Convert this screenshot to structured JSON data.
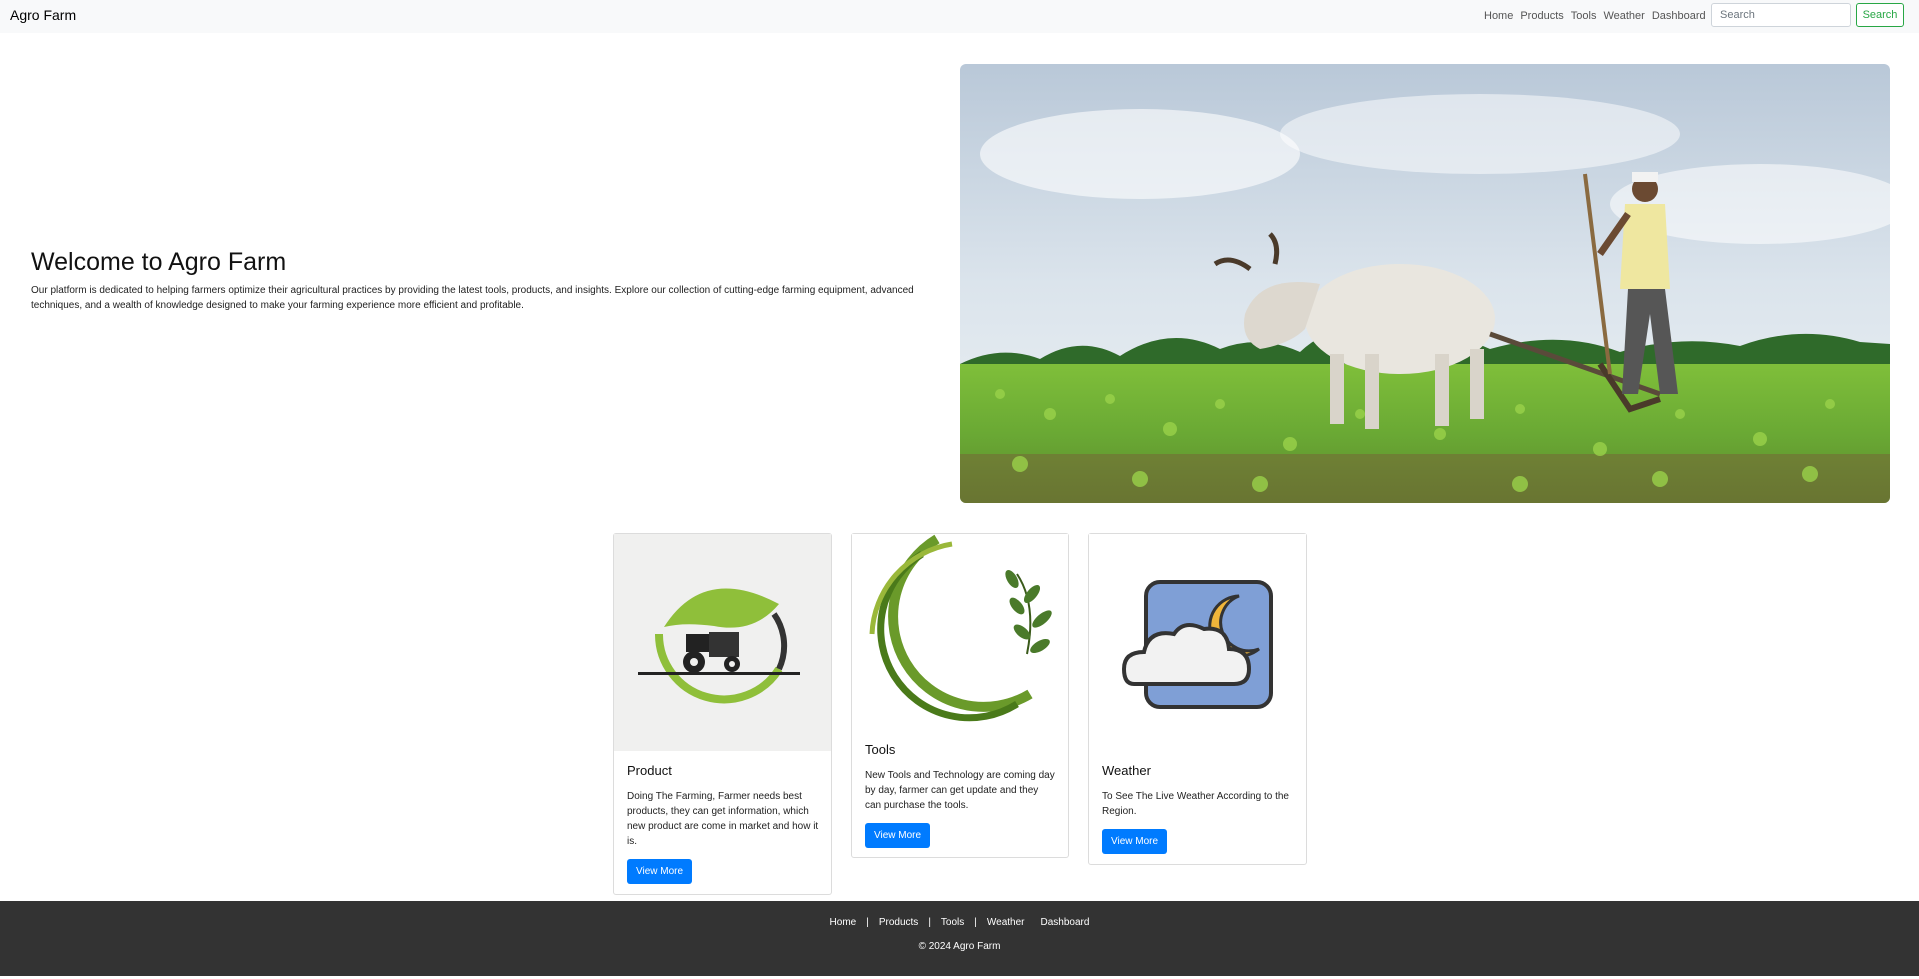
{
  "navbar": {
    "brand": "Agro Farm",
    "links": [
      "Home",
      "Products",
      "Tools",
      "Weather",
      "Dashboard"
    ],
    "search_placeholder": "Search",
    "search_button": "Search"
  },
  "hero": {
    "title": "Welcome to Agro Farm",
    "text": "Our platform is dedicated to helping farmers optimize their agricultural practices by providing the latest tools, products, and insights. Explore our collection of cutting-edge farming equipment, advanced techniques, and a wealth of knowledge designed to make your farming experience more efficient and profitable."
  },
  "cards": [
    {
      "title": "Product",
      "text": "Doing The Farming, Farmer needs best products, they can get information, which new product are come in market and how it is.",
      "button": "View More"
    },
    {
      "title": "Tools",
      "text": "New Tools and Technology are coming day by day, farmer can get update and they can purchase the tools.",
      "button": "View More"
    },
    {
      "title": "Weather",
      "text": "To See The Live Weather According to the Region.",
      "button": "View More"
    }
  ],
  "footer": {
    "links": [
      "Home",
      "Products",
      "Tools",
      "Weather",
      "Dashboard"
    ],
    "copyright": "© 2024 Agro Farm"
  },
  "colors": {
    "primary": "#007bff",
    "success": "#28a745",
    "footer_bg": "#333333",
    "navbar_bg": "#f8f9fa"
  },
  "icons": {
    "product_card": "tractor-leaf-logo",
    "tools_card": "leaf-circle-logo",
    "weather_card": "cloud-moon-icon"
  }
}
